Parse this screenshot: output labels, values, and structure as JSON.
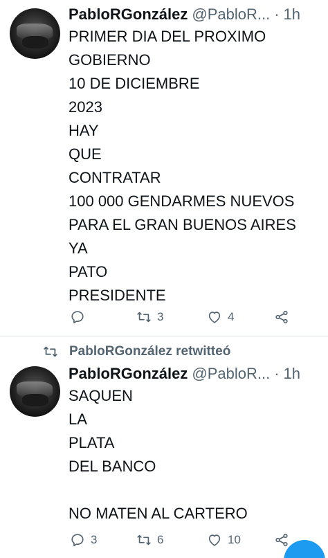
{
  "tweets": [
    {
      "author_name": "PabloRGonzález",
      "author_handle": "@PabloR...",
      "separator": "·",
      "time": "1h",
      "lines": [
        "PRIMER DIA DEL PROXIMO",
        "GOBIERNO",
        "10 DE DICIEMBRE",
        "2023",
        "HAY",
        "QUE",
        "CONTRATAR",
        "100 000 GENDARMES NUEVOS",
        "PARA EL GRAN BUENOS AIRES",
        "YA",
        "PATO",
        "PRESIDENTE"
      ],
      "reply_count": "",
      "retweet_count": "3",
      "like_count": "4"
    },
    {
      "retweet_context": "PabloRGonzález retwitteó",
      "author_name": "PabloRGonzález",
      "author_handle": "@PabloR...",
      "separator": "·",
      "time": "1h",
      "lines": [
        "SAQUEN",
        "LA",
        "PLATA",
        "DEL BANCO",
        "",
        "NO MATEN AL CARTERO"
      ],
      "reply_count": "3",
      "retweet_count": "6",
      "like_count": "10"
    }
  ],
  "icons": {
    "reply": "reply-icon",
    "retweet": "retweet-icon",
    "like": "heart-icon",
    "share": "share-icon",
    "compose": "compose-fab"
  },
  "colors": {
    "text": "#0f1419",
    "secondary": "#536471",
    "divider": "#e6ecf0",
    "accent": "#1d9bf0"
  }
}
